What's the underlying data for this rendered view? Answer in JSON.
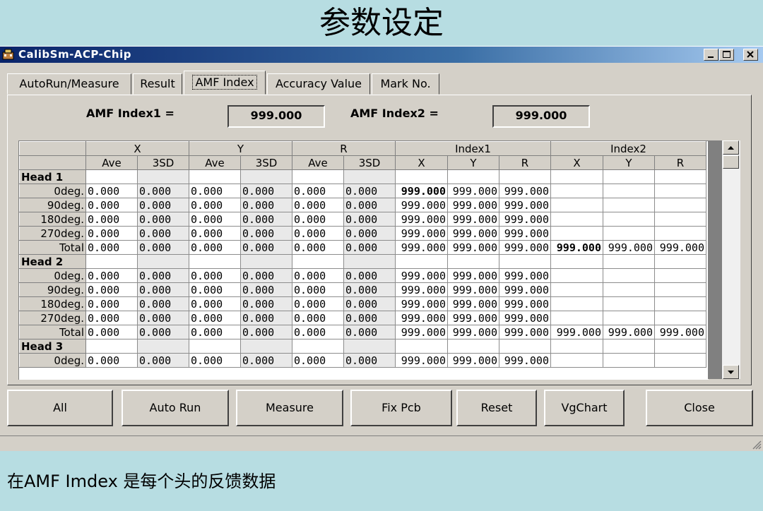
{
  "slide": {
    "title": "参数设定",
    "caption": "在AMF Imdex 是每个头的反馈数据"
  },
  "window": {
    "title": "CalibSm-ACP-Chip",
    "icons": [
      "app-icon",
      "minimize-icon",
      "maximize-icon",
      "close-icon"
    ]
  },
  "tabs": [
    {
      "label": "AutoRun/Measure",
      "active": false
    },
    {
      "label": "Result",
      "active": false
    },
    {
      "label": "AMF Index",
      "active": true
    },
    {
      "label": "Accuracy Value",
      "active": false
    },
    {
      "label": "Mark No.",
      "active": false
    }
  ],
  "amf": {
    "index1_label": "AMF Index1 =",
    "index1_value": "999.000",
    "index2_label": "AMF Index2 =",
    "index2_value": "999.000"
  },
  "grid": {
    "groups": [
      "X",
      "Y",
      "R",
      "Index1",
      "Index2"
    ],
    "subheaders": [
      "Ave",
      "3SD",
      "Ave",
      "3SD",
      "Ave",
      "3SD",
      "X",
      "Y",
      "R",
      "X",
      "Y",
      "R"
    ],
    "rows": [
      {
        "type": "head",
        "label": "Head 1"
      },
      {
        "type": "data",
        "label": "0deg.",
        "vals": [
          "0.000",
          "0.000",
          "0.000",
          "0.000",
          "0.000",
          "0.000"
        ],
        "idx1": [
          "999.000",
          "999.000",
          "999.000"
        ],
        "idx2": [],
        "sel": true
      },
      {
        "type": "data",
        "label": "90deg.",
        "vals": [
          "0.000",
          "0.000",
          "0.000",
          "0.000",
          "0.000",
          "0.000"
        ],
        "idx1": [
          "999.000",
          "999.000",
          "999.000"
        ],
        "idx2": []
      },
      {
        "type": "data",
        "label": "180deg.",
        "vals": [
          "0.000",
          "0.000",
          "0.000",
          "0.000",
          "0.000",
          "0.000"
        ],
        "idx1": [
          "999.000",
          "999.000",
          "999.000"
        ],
        "idx2": []
      },
      {
        "type": "data",
        "label": "270deg.",
        "vals": [
          "0.000",
          "0.000",
          "0.000",
          "0.000",
          "0.000",
          "0.000"
        ],
        "idx1": [
          "999.000",
          "999.000",
          "999.000"
        ],
        "idx2": []
      },
      {
        "type": "data",
        "label": "Total",
        "vals": [
          "0.000",
          "0.000",
          "0.000",
          "0.000",
          "0.000",
          "0.000"
        ],
        "idx1": [
          "999.000",
          "999.000",
          "999.000"
        ],
        "idx2": [
          "999.000",
          "999.000",
          "999.000"
        ],
        "sel2": true
      },
      {
        "type": "head",
        "label": "Head 2"
      },
      {
        "type": "data",
        "label": "0deg.",
        "vals": [
          "0.000",
          "0.000",
          "0.000",
          "0.000",
          "0.000",
          "0.000"
        ],
        "idx1": [
          "999.000",
          "999.000",
          "999.000"
        ],
        "idx2": []
      },
      {
        "type": "data",
        "label": "90deg.",
        "vals": [
          "0.000",
          "0.000",
          "0.000",
          "0.000",
          "0.000",
          "0.000"
        ],
        "idx1": [
          "999.000",
          "999.000",
          "999.000"
        ],
        "idx2": []
      },
      {
        "type": "data",
        "label": "180deg.",
        "vals": [
          "0.000",
          "0.000",
          "0.000",
          "0.000",
          "0.000",
          "0.000"
        ],
        "idx1": [
          "999.000",
          "999.000",
          "999.000"
        ],
        "idx2": []
      },
      {
        "type": "data",
        "label": "270deg.",
        "vals": [
          "0.000",
          "0.000",
          "0.000",
          "0.000",
          "0.000",
          "0.000"
        ],
        "idx1": [
          "999.000",
          "999.000",
          "999.000"
        ],
        "idx2": []
      },
      {
        "type": "data",
        "label": "Total",
        "vals": [
          "0.000",
          "0.000",
          "0.000",
          "0.000",
          "0.000",
          "0.000"
        ],
        "idx1": [
          "999.000",
          "999.000",
          "999.000"
        ],
        "idx2": [
          "999.000",
          "999.000",
          "999.000"
        ]
      },
      {
        "type": "head",
        "label": "Head 3"
      },
      {
        "type": "data",
        "label": "0deg.",
        "vals": [
          "0.000",
          "0.000",
          "0.000",
          "0.000",
          "0.000",
          "0.000"
        ],
        "idx1": [
          "999.000",
          "999.000",
          "999.000"
        ],
        "idx2": []
      }
    ]
  },
  "buttons": {
    "all": "All",
    "auto_run": "Auto Run",
    "measure": "Measure",
    "fix_pcb": "Fix Pcb",
    "reset": "Reset",
    "vgchart": "VgChart",
    "close": "Close"
  }
}
